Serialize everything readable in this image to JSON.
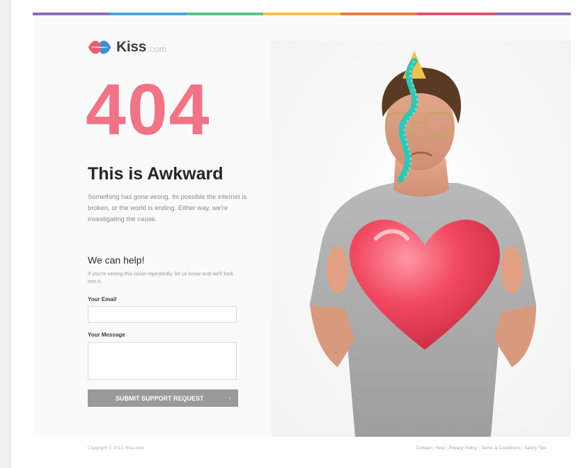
{
  "brand": {
    "name": "Kiss",
    "suffix": ".com"
  },
  "error": {
    "code": "404",
    "title": "This is Awkward",
    "description": "Something has gone wrong. Its possible the internet is broken, or the world is ending. Either way, we're investigating the cause."
  },
  "help": {
    "title": "We can help!",
    "text": "If you're seeing this issue repeatedly, let us know and we'll look into it.",
    "email_label": "Your Email",
    "email_value": "",
    "message_label": "Your Message",
    "message_value": "",
    "submit_label": "SUBMIT SUPPORT REQUEST",
    "submit_arrow": "›"
  },
  "footer": {
    "copyright": "Copyright © 2013, Kiss.com",
    "links": [
      "Contact",
      "Help",
      "Privacy Policy",
      "Terms & Conditions",
      "Safety Tips"
    ]
  },
  "colors": {
    "accent": "#f07386",
    "button": "#9a9a9a",
    "top_bar": [
      "#8e6bb5",
      "#4aa3d8",
      "#5bbf8e",
      "#f3c443",
      "#f07a3c",
      "#ea4f6b",
      "#8e6bb5"
    ]
  },
  "icons": {
    "logo": "lips-logo-icon",
    "arrow": "chevron-right-icon"
  }
}
